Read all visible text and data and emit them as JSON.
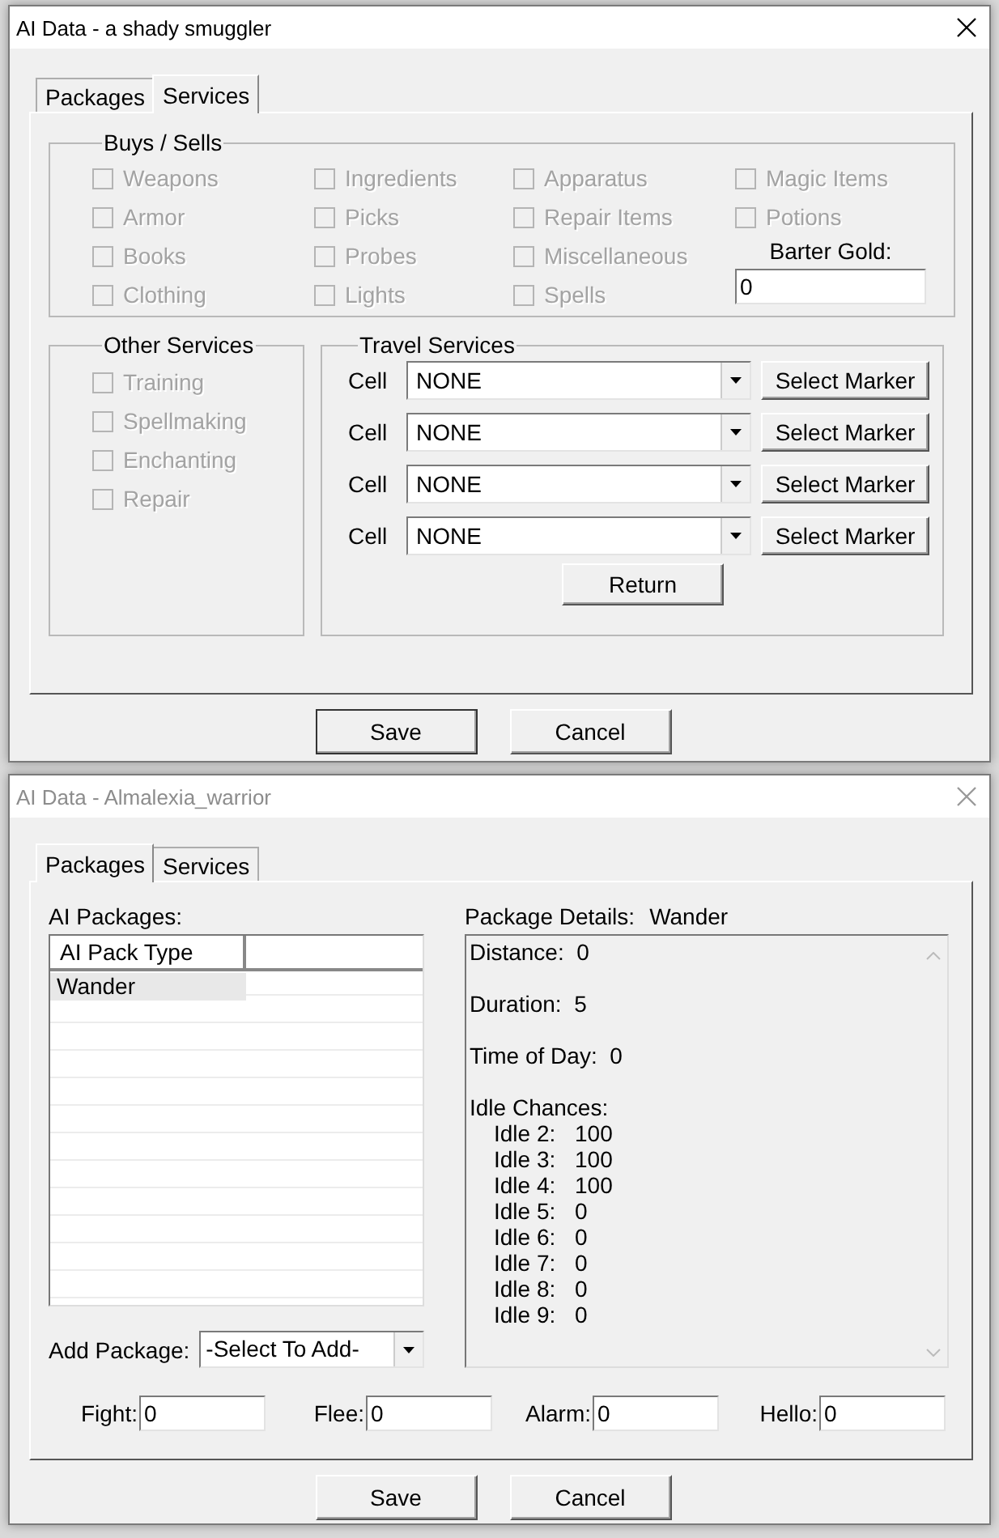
{
  "windows": [
    {
      "kind": "services",
      "title": "AI Data - a shady smuggler",
      "active": true,
      "tabs": [
        {
          "label": "Packages",
          "selected": false
        },
        {
          "label": "Services",
          "selected": true
        }
      ],
      "buys_sells": {
        "title": "Buys / Sells",
        "items": [
          {
            "label": "Weapons",
            "checked": false,
            "disabled": true
          },
          {
            "label": "Armor",
            "checked": false,
            "disabled": true
          },
          {
            "label": "Books",
            "checked": false,
            "disabled": true
          },
          {
            "label": "Clothing",
            "checked": false,
            "disabled": true
          },
          {
            "label": "Ingredients",
            "checked": false,
            "disabled": true
          },
          {
            "label": "Picks",
            "checked": false,
            "disabled": true
          },
          {
            "label": "Probes",
            "checked": false,
            "disabled": true
          },
          {
            "label": "Lights",
            "checked": false,
            "disabled": true
          },
          {
            "label": "Apparatus",
            "checked": false,
            "disabled": true
          },
          {
            "label": "Repair Items",
            "checked": false,
            "disabled": true
          },
          {
            "label": "Miscellaneous",
            "checked": false,
            "disabled": true
          },
          {
            "label": "Spells",
            "checked": false,
            "disabled": true
          },
          {
            "label": "Magic Items",
            "checked": false,
            "disabled": true
          },
          {
            "label": "Potions",
            "checked": false,
            "disabled": true
          }
        ],
        "barter_gold": {
          "label": "Barter Gold:",
          "value": "0"
        }
      },
      "other_services": {
        "title": "Other Services",
        "items": [
          {
            "label": "Training",
            "checked": false,
            "disabled": true
          },
          {
            "label": "Spellmaking",
            "checked": false,
            "disabled": true
          },
          {
            "label": "Enchanting",
            "checked": false,
            "disabled": true
          },
          {
            "label": "Repair",
            "checked": false,
            "disabled": true
          }
        ]
      },
      "travel_services": {
        "title": "Travel Services",
        "rows": [
          {
            "label": "Cell",
            "value": "NONE",
            "button": "Select Marker"
          },
          {
            "label": "Cell",
            "value": "NONE",
            "button": "Select Marker"
          },
          {
            "label": "Cell",
            "value": "NONE",
            "button": "Select Marker"
          },
          {
            "label": "Cell",
            "value": "NONE",
            "button": "Select Marker"
          }
        ],
        "return_button": "Return"
      },
      "buttons": [
        "Save",
        "Cancel"
      ]
    },
    {
      "kind": "packages",
      "title": "AI Data - Almalexia_warrior",
      "active": false,
      "tabs": [
        {
          "label": "Packages",
          "selected": true
        },
        {
          "label": "Services",
          "selected": false
        }
      ],
      "ai_packages": {
        "label": "AI Packages:",
        "columns": [
          "AI Pack Type"
        ],
        "rows": [
          {
            "type": "Wander",
            "selected": true
          }
        ]
      },
      "details": {
        "label": "Package Details:",
        "name": "Wander",
        "fields": [
          {
            "label": "Distance:",
            "value": "0"
          },
          {
            "label": "Duration:",
            "value": "5"
          },
          {
            "label": "Time of Day:",
            "value": "0"
          }
        ],
        "idle_chances": {
          "label": "Idle Chances:",
          "items": [
            {
              "label": "Idle 2:",
              "value": "100"
            },
            {
              "label": "Idle 3:",
              "value": "100"
            },
            {
              "label": "Idle 4:",
              "value": "100"
            },
            {
              "label": "Idle 5:",
              "value": "0"
            },
            {
              "label": "Idle 6:",
              "value": "0"
            },
            {
              "label": "Idle 7:",
              "value": "0"
            },
            {
              "label": "Idle 8:",
              "value": "0"
            },
            {
              "label": "Idle 9:",
              "value": "0"
            }
          ]
        }
      },
      "add_package": {
        "label": "Add Package:",
        "value": "-Select To Add-"
      },
      "attributes": [
        {
          "label": "Fight:",
          "value": "0"
        },
        {
          "label": "Flee:",
          "value": "0"
        },
        {
          "label": "Alarm:",
          "value": "0"
        },
        {
          "label": "Hello:",
          "value": "0"
        }
      ],
      "buttons": [
        "Save",
        "Cancel"
      ]
    }
  ]
}
